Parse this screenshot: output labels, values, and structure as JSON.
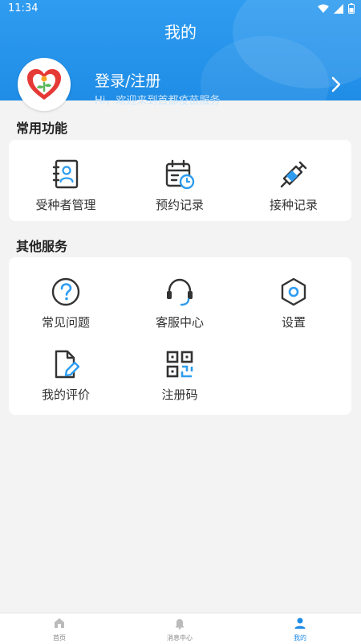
{
  "status_bar": {
    "time": "11:34"
  },
  "header": {
    "title": "我的",
    "login_label": "登录/注册",
    "welcome_text": "Hi，欢迎来到首都疫苗服务"
  },
  "common_functions": {
    "title": "常用功能",
    "items": [
      {
        "label": "受种者管理",
        "icon": "recipient-icon"
      },
      {
        "label": "预约记录",
        "icon": "calendar-clock-icon"
      },
      {
        "label": "接种记录",
        "icon": "syringe-icon"
      }
    ]
  },
  "other_services": {
    "title": "其他服务",
    "items": [
      {
        "label": "常见问题",
        "icon": "question-icon"
      },
      {
        "label": "客服中心",
        "icon": "headset-icon"
      },
      {
        "label": "设置",
        "icon": "settings-icon"
      },
      {
        "label": "我的评价",
        "icon": "edit-document-icon"
      },
      {
        "label": "注册码",
        "icon": "qr-code-icon"
      }
    ]
  },
  "tabbar": {
    "tabs": [
      {
        "label": "首页",
        "active": false
      },
      {
        "label": "消息中心",
        "active": false
      },
      {
        "label": "我的",
        "active": true
      }
    ]
  },
  "colors": {
    "primary": "#1f8de6",
    "accent": "#2d9cf0"
  }
}
